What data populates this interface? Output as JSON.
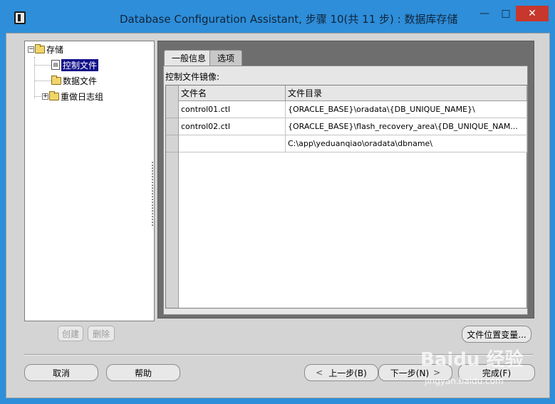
{
  "window": {
    "title": "Database Configuration Assistant, 步骤 10(共 11 步) : 数据库存储",
    "min_glyph": "—",
    "max_glyph": "□",
    "close_glyph": "✕"
  },
  "tree": {
    "root": {
      "label": "存储",
      "expander": "−"
    },
    "items": [
      {
        "label": "控制文件",
        "icon": "control-file-icon",
        "selected": true
      },
      {
        "label": "数据文件",
        "icon": "folder-icon",
        "selected": false
      },
      {
        "label": "重做日志组",
        "icon": "folder-icon",
        "expander": "+",
        "selected": false
      }
    ]
  },
  "tabs": [
    {
      "label": "一般信息",
      "active": true
    },
    {
      "label": "选项",
      "active": false
    }
  ],
  "general": {
    "mirror_label": "控制文件镜像:",
    "columns": [
      "文件名",
      "文件目录"
    ],
    "rows": [
      {
        "name": "control01.ctl",
        "dir": "{ORACLE_BASE}\\oradata\\{DB_UNIQUE_NAME}\\"
      },
      {
        "name": "control02.ctl",
        "dir": "{ORACLE_BASE}\\flash_recovery_area\\{DB_UNIQUE_NAM..."
      },
      {
        "name": "",
        "dir": "C:\\app\\yeduanqiao\\oradata\\dbname\\"
      }
    ]
  },
  "buttons": {
    "create": "创建",
    "delete": "删除",
    "file_location_vars": "文件位置变量...",
    "cancel": "取消",
    "help": "帮助",
    "back": "上一步(B)",
    "next": "下一步(N)",
    "finish": "完成(F)"
  },
  "watermark": {
    "logo": "Baidu 经验",
    "url": "jingyan.baidu.com"
  },
  "colors": {
    "title_bg": "#2e8ed9",
    "close_bg": "#c7372c",
    "selection": "#12128a",
    "panel_dark": "#6e6e6e",
    "dialog_bg": "#d4d4d4"
  }
}
